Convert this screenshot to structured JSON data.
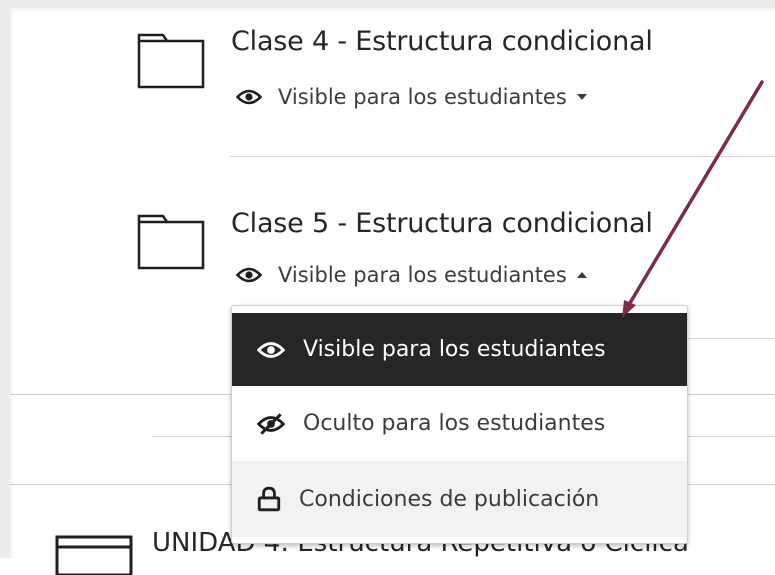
{
  "items": [
    {
      "title": "Clase 4 - Estructura condicional",
      "visibility": "Visible para los estudiantes"
    },
    {
      "title": "Clase 5 - Estructura condicional",
      "visibility": "Visible para los estudiantes"
    }
  ],
  "dropdown": {
    "options": [
      {
        "label": "Visible para los estudiantes",
        "icon": "eye-icon",
        "selected": true
      },
      {
        "label": "Oculto para los estudiantes",
        "icon": "eye-slash-icon",
        "selected": false
      },
      {
        "label": "Condiciones de publicación",
        "icon": "lock-icon",
        "selected": false
      }
    ]
  },
  "unit": {
    "title": "UNIDAD 4: Estructura Repetitiva o Cíclica"
  },
  "colors": {
    "selected_bg": "#262626",
    "annotation_arrow": "#7b2c46",
    "text": "#262626"
  }
}
